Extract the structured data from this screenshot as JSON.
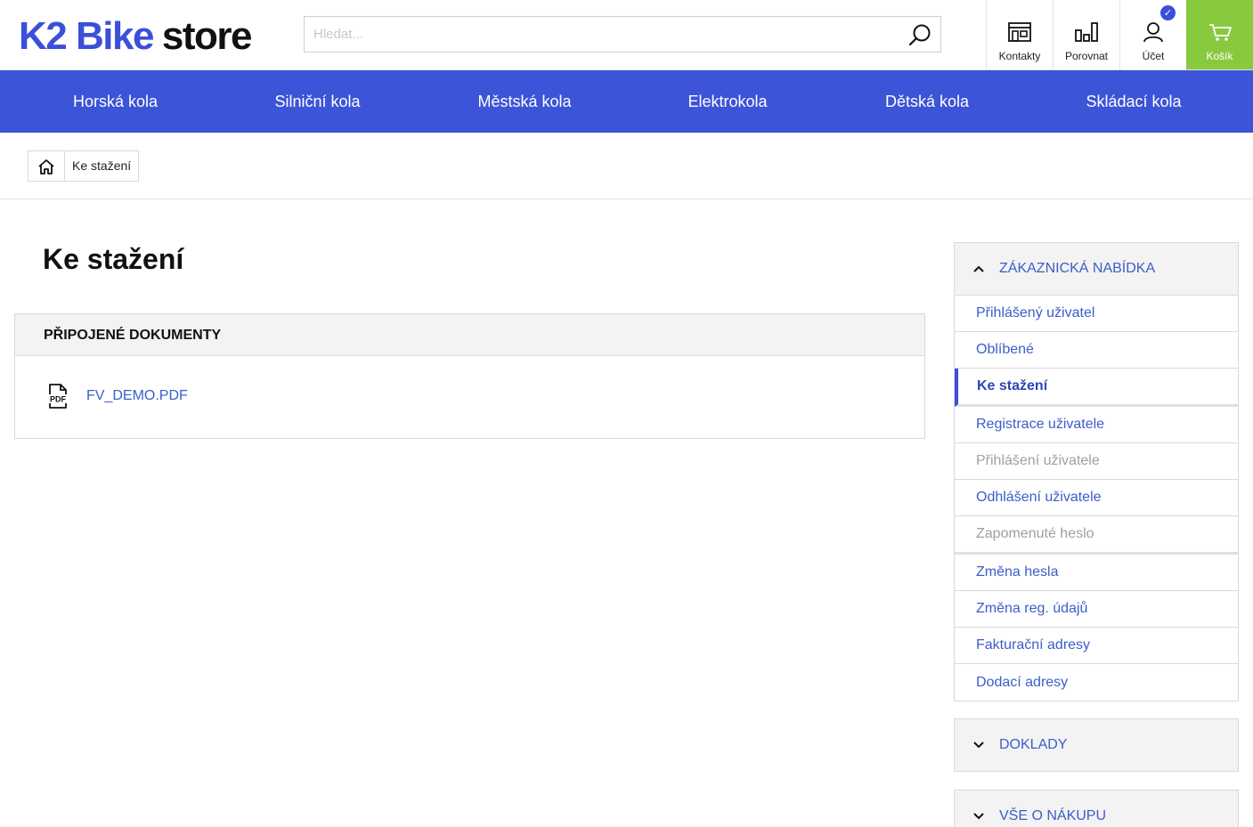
{
  "header": {
    "logo_part1": "K2 Bike",
    "logo_part2": "store",
    "search_placeholder": "Hledat...",
    "buttons": {
      "contacts": "Kontakty",
      "compare": "Porovnat",
      "account": "Účet",
      "cart": "Košík"
    },
    "account_badge": "✓"
  },
  "nav": {
    "items": [
      "Horská kola",
      "Silniční kola",
      "Městská kola",
      "Elektrokola",
      "Dětská kola",
      "Skládací kola"
    ]
  },
  "breadcrumb": {
    "current": "Ke stažení"
  },
  "main": {
    "title": "Ke stažení",
    "documents_header": "PŘIPOJENÉ DOKUMENTY",
    "documents": [
      {
        "name": "FV_DEMO.PDF",
        "icon": "pdf-file-icon"
      }
    ]
  },
  "sidebar": {
    "sections": [
      {
        "title": "ZÁKAZNICKÁ NABÍDKA",
        "expanded": true,
        "items": [
          {
            "label": "Přihlášený uživatel"
          },
          {
            "label": "Oblíbené"
          },
          {
            "label": "Ke stažení",
            "active": true
          },
          {
            "label": "Registrace uživatele"
          },
          {
            "label": "Přihlášení uživatele",
            "disabled": true
          },
          {
            "label": "Odhlášení uživatele"
          },
          {
            "label": "Zapomenuté heslo",
            "disabled": true
          },
          {
            "label": "Změna hesla"
          },
          {
            "label": "Změna reg. údajů"
          },
          {
            "label": "Fakturační adresy"
          },
          {
            "label": "Dodací adresy"
          }
        ]
      },
      {
        "title": "DOKLADY",
        "expanded": false
      },
      {
        "title": "VŠE O NÁKUPU",
        "expanded": false
      }
    ]
  },
  "colors": {
    "brand_blue": "#3b54d8",
    "link_blue": "#3b5ec8",
    "cart_green": "#89c93d"
  }
}
